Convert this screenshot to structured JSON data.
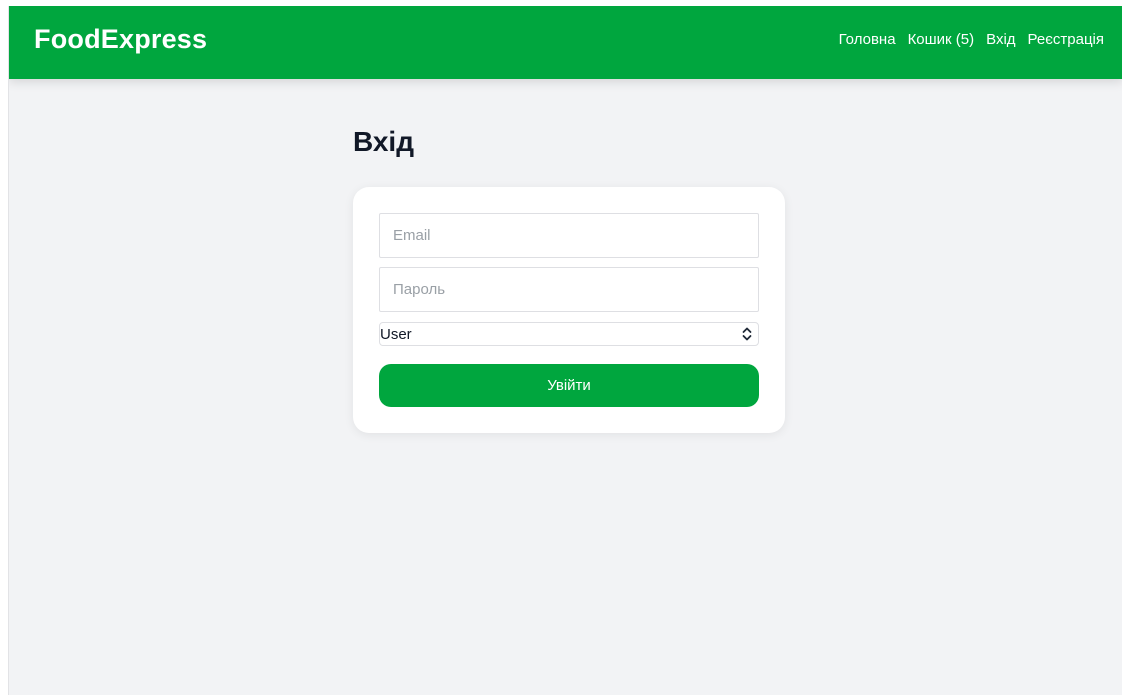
{
  "navbar": {
    "brand": "FoodExpress",
    "links": [
      {
        "label": "Головна"
      },
      {
        "label": "Кошик (5)"
      },
      {
        "label": "Вхід"
      },
      {
        "label": "Реєстрація"
      }
    ]
  },
  "page": {
    "title": "Вхід"
  },
  "form": {
    "email": {
      "placeholder": "Email",
      "value": ""
    },
    "password": {
      "placeholder": "Пароль",
      "value": ""
    },
    "role": {
      "selected": "User"
    },
    "submit_label": "Увійти"
  },
  "colors": {
    "brand_green": "#00a63e",
    "background": "#f2f3f5",
    "card": "#ffffff",
    "title_text": "#111827"
  },
  "icons": {
    "select": "chevron-up-down-icon"
  }
}
